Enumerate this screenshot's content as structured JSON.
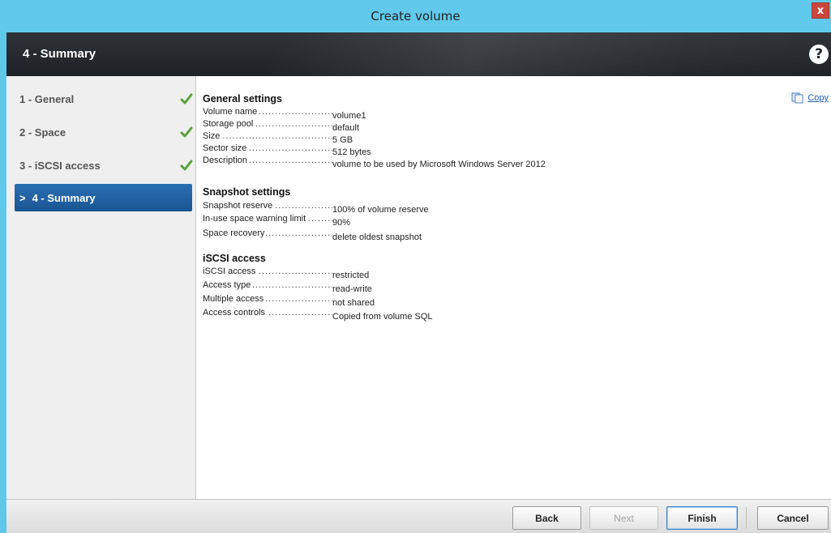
{
  "window": {
    "title": "Create volume",
    "close_label": "x"
  },
  "header": {
    "step_title": "4 - Summary",
    "help_label": "?"
  },
  "nav": {
    "items": [
      {
        "label": "1 - General",
        "completed": true
      },
      {
        "label": "2 - Space",
        "completed": true
      },
      {
        "label": "3 - iSCSI access",
        "completed": true
      },
      {
        "label": "4 - Summary",
        "active": true,
        "marker": ">"
      }
    ]
  },
  "content": {
    "copy_label": "Copy",
    "sections": [
      {
        "title": "General settings",
        "rows": [
          {
            "label": "Volume name",
            "value": "volume1"
          },
          {
            "label": "Storage pool",
            "value": "default"
          },
          {
            "label": "Size",
            "value": "5 GB"
          },
          {
            "label": "Sector size",
            "value": "512 bytes"
          },
          {
            "label": "Description",
            "value": "volume to be used by Microsoft Windows Server 2012"
          }
        ]
      },
      {
        "title": "Snapshot settings",
        "rows": [
          {
            "label": "Snapshot reserve",
            "value": "100% of volume reserve"
          },
          {
            "label": "In-use space warning limit",
            "value": "90%"
          },
          {
            "label": "Space recovery",
            "value": "delete oldest snapshot"
          }
        ]
      },
      {
        "title": "iSCSI access",
        "rows": [
          {
            "label": "iSCSI access",
            "value": "restricted"
          },
          {
            "label": "Access type",
            "value": "read-write"
          },
          {
            "label": "Multiple access",
            "value": "not shared"
          },
          {
            "label": "Access controls",
            "value": "Copied from volume SQL"
          }
        ]
      }
    ]
  },
  "footer": {
    "back_label": "Back",
    "next_label": "Next",
    "finish_label": "Finish",
    "cancel_label": "Cancel"
  },
  "colors": {
    "titlebar": "#61c9eb",
    "header_band": "#1d2226",
    "active_step": "#1a5592",
    "check": "#5aa03c",
    "link": "#1c5ba7"
  }
}
